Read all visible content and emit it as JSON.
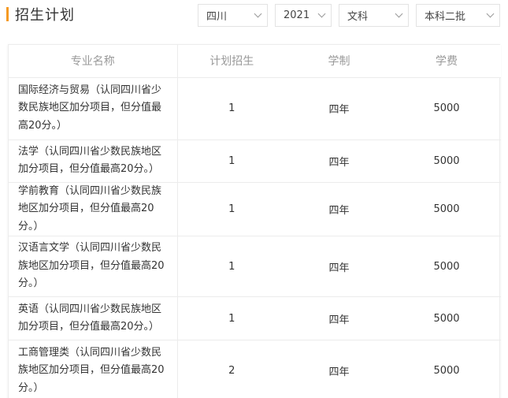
{
  "header": {
    "title": "招生计划",
    "accent_color": "#f59a23"
  },
  "filters": {
    "province": "四川",
    "year": "2021",
    "subject_type": "文科",
    "batch": "本科二批"
  },
  "table": {
    "headers": [
      "专业名称",
      "计划招生",
      "学制",
      "学费"
    ],
    "rows": [
      {
        "major": "国际经济与贸易（认同四川省少数民族地区加分项目，但分值最高20分。）",
        "plan": "1",
        "duration": "四年",
        "fee": "5000"
      },
      {
        "major": "法学（认同四川省少数民族地区加分项目，但分值最高20分。）",
        "plan": "1",
        "duration": "四年",
        "fee": "5000"
      },
      {
        "major": "学前教育（认同四川省少数民族地区加分项目，但分值最高20分。）",
        "plan": "1",
        "duration": "四年",
        "fee": "5000"
      },
      {
        "major": "汉语言文学（认同四川省少数民族地区加分项目，但分值最高20分。）",
        "plan": "1",
        "duration": "四年",
        "fee": "5000"
      },
      {
        "major": "英语（认同四川省少数民族地区加分项目，但分值最高20分。）",
        "plan": "1",
        "duration": "四年",
        "fee": "5000"
      },
      {
        "major": "工商管理类（认同四川省少数民族地区加分项目，但分值最高20分。）",
        "plan": "2",
        "duration": "四年",
        "fee": "5000"
      }
    ]
  }
}
